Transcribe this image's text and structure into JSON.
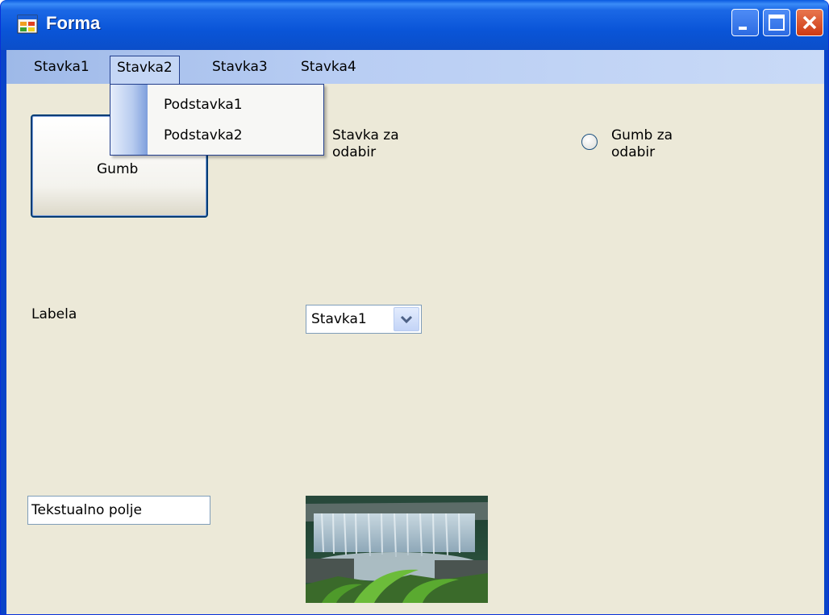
{
  "window": {
    "title": "Forma"
  },
  "menu": {
    "items": [
      "Stavka1",
      "Stavka2",
      "Stavka3",
      "Stavka4"
    ],
    "open_menu": "Stavka2",
    "submenu": [
      "Podstavka1",
      "Podstavka2"
    ]
  },
  "controls": {
    "button_label": "Gumb",
    "checkbox_label": "Stavka za odabir",
    "radio_label": "Gumb za odabir",
    "label_text": "Labela",
    "combo_value": "Stavka1",
    "textbox_value": "Tekstualno polje"
  },
  "icons": [
    "app-icon",
    "minimize-icon",
    "maximize-icon",
    "close-icon",
    "chevron-down-icon"
  ],
  "colors": {
    "titlebar": "#0a55d8",
    "client_bg": "#ece9d8",
    "close_button": "#cc3a14",
    "menu_highlight": "#c4d6f5"
  }
}
